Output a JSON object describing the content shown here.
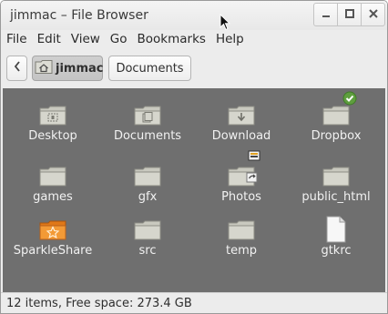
{
  "window": {
    "title": "jimmac – File Browser",
    "buttons": [
      "minimize-icon",
      "maximize-icon",
      "close-icon"
    ]
  },
  "menubar": {
    "items": [
      "File",
      "Edit",
      "View",
      "Go",
      "Bookmarks",
      "Help"
    ]
  },
  "toolbar": {
    "back_icon": "chevron-left-icon",
    "breadcrumbs": [
      {
        "label": "jimmac",
        "icon": "home-folder-icon",
        "active": true
      },
      {
        "label": "Documents",
        "active": false
      }
    ]
  },
  "files": [
    {
      "name": "Desktop",
      "icon": "desktop-folder-icon"
    },
    {
      "name": "Documents",
      "icon": "documents-folder-icon"
    },
    {
      "name": "Download",
      "icon": "download-folder-icon"
    },
    {
      "name": "Dropbox",
      "icon": "folder-synced-icon"
    },
    {
      "name": "games",
      "icon": "folder-icon"
    },
    {
      "name": "gfx",
      "icon": "folder-icon"
    },
    {
      "name": "Photos",
      "icon": "folder-shared-link-icon"
    },
    {
      "name": "public_html",
      "icon": "folder-icon"
    },
    {
      "name": "SparkleShare",
      "icon": "sparkleshare-folder-icon"
    },
    {
      "name": "src",
      "icon": "folder-icon"
    },
    {
      "name": "temp",
      "icon": "folder-icon"
    },
    {
      "name": "gtkrc",
      "icon": "text-file-icon"
    }
  ],
  "status": {
    "text": "12 items, Free space: 273.4 GB"
  },
  "colors": {
    "content_bg": "#6f6f6f",
    "folder": "#d2d2c8",
    "sparkleshare": "#f08a24",
    "synced_badge": "#6aa84f"
  }
}
